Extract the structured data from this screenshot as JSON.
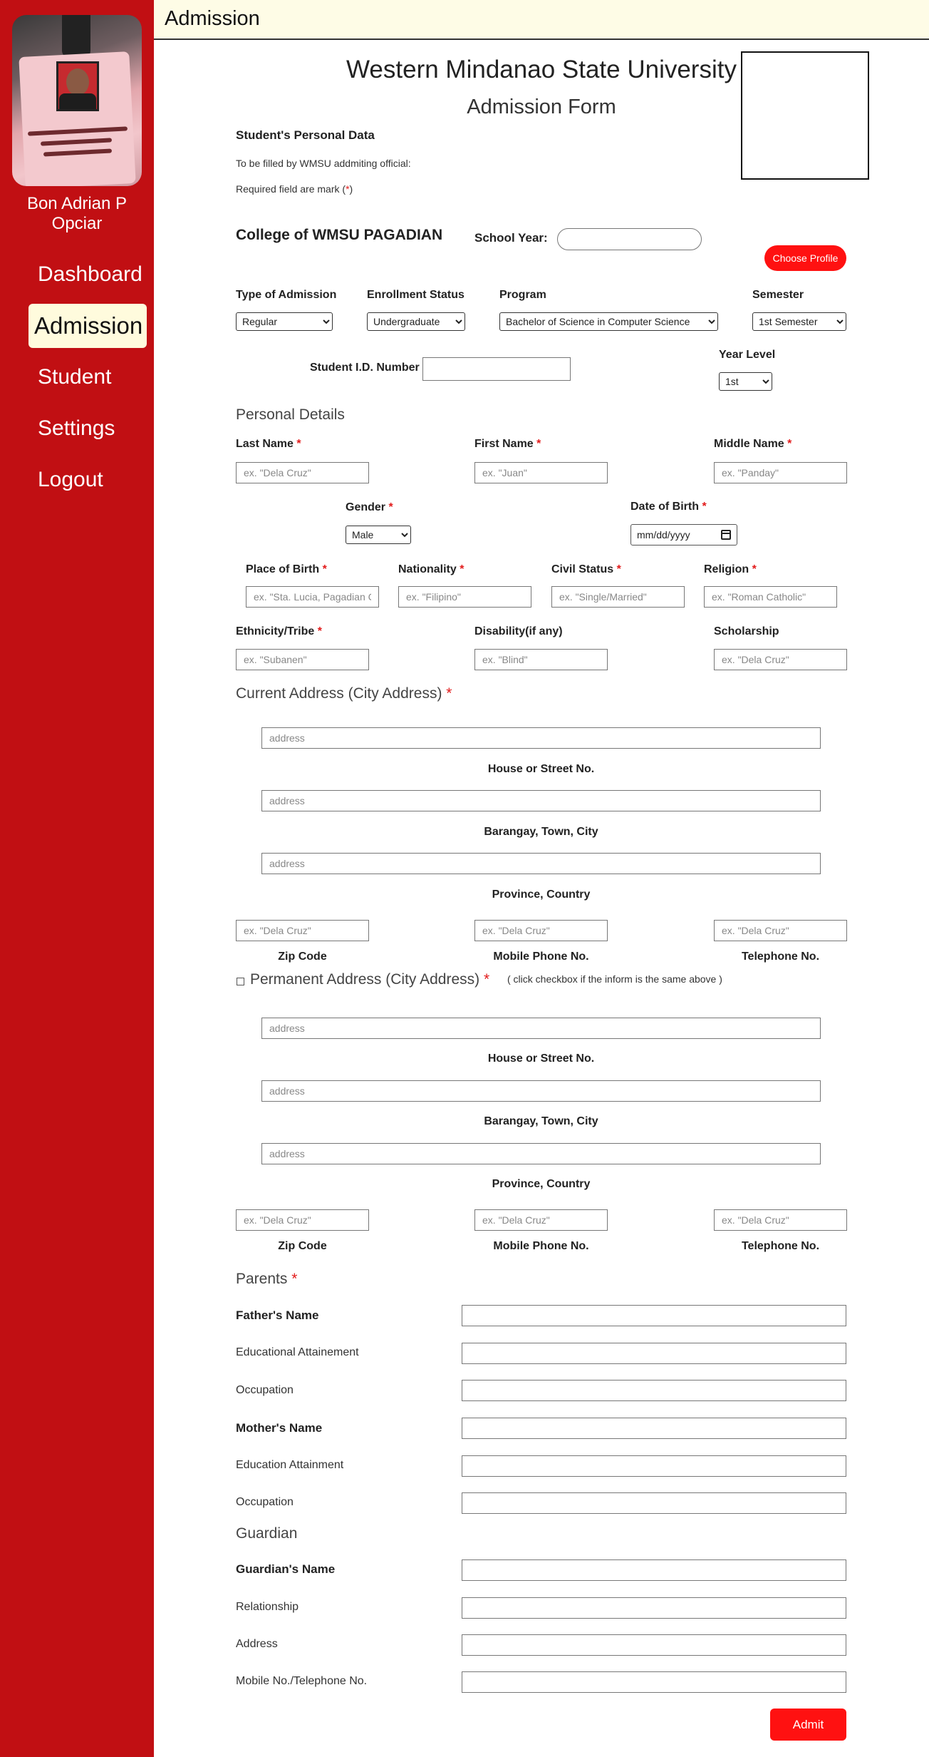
{
  "sidebar": {
    "user_name": "Bon Adrian P Opciar",
    "nav": [
      "Dashboard",
      "Admission",
      "Student",
      "Settings",
      "Logout"
    ],
    "active": "Admission",
    "id_card_text": [
      "BON ADRIAN P. OPCIAR",
      "Instructor I",
      "WMSU PAGADIAN"
    ]
  },
  "topbar": {
    "title": "Admission"
  },
  "header": {
    "university": "Western Mindanao State University",
    "form_title": "Admission Form",
    "personal_data": "Student's Personal Data",
    "official_note": "To be filled by WMSU addmiting official:",
    "required_note": "Required field are mark (",
    "required_star": "*",
    "required_close": ")"
  },
  "college": {
    "name": "College of WMSU PAGADIAN",
    "school_year_label": "School Year:",
    "school_year_value": "",
    "choose_profile": "Choose Profile"
  },
  "admission": {
    "type_label": "Type of Admission",
    "type_value": "Regular",
    "status_label": "Enrollment Status",
    "status_value": "Undergraduate",
    "program_label": "Program",
    "program_value": "Bachelor of Science in Computer Science",
    "semester_label": "Semester",
    "semester_value": "1st Semester",
    "student_id_label": "Student I.D. Number",
    "student_id_value": "",
    "year_level_label": "Year Level",
    "year_level_value": "1st"
  },
  "personal": {
    "heading": "Personal Details",
    "last_name_label": "Last Name",
    "last_name_ph": "ex. \"Dela Cruz\"",
    "first_name_label": "First Name",
    "first_name_ph": "ex. \"Juan\"",
    "middle_name_label": "Middle Name",
    "middle_name_ph": "ex. \"Panday\"",
    "gender_label": "Gender",
    "gender_value": "Male",
    "dob_label": "Date of Birth",
    "dob_value": "mm/dd/yyyy",
    "pob_label": "Place of Birth",
    "pob_ph": "ex. \"Sta. Lucia, Pagadian City\"",
    "nationality_label": "Nationality",
    "nationality_ph": "ex. \"Filipino\"",
    "civil_label": "Civil Status",
    "civil_ph": "ex. \"Single/Married\"",
    "religion_label": "Religion",
    "religion_ph": "ex. \"Roman Catholic\"",
    "ethnicity_label": "Ethnicity/Tribe",
    "ethnicity_ph": "ex. \"Subanen\"",
    "disability_label": "Disability(if any)",
    "disability_ph": "ex. \"Blind\"",
    "scholarship_label": "Scholarship",
    "scholarship_ph": "ex. \"Dela Cruz\""
  },
  "current_address": {
    "heading": "Current Address (City Address)",
    "address_ph": "address",
    "house_label": "House or Street No.",
    "barangay_label": "Barangay, Town, City",
    "province_label": "Province, Country",
    "zip_label": "Zip Code",
    "mobile_label": "Mobile Phone No.",
    "tel_label": "Telephone No.",
    "small_ph": "ex. \"Dela Cruz\""
  },
  "permanent_address": {
    "heading": "Permanent Address (City Address)",
    "note": "( click checkbox if the inform is the same above )",
    "address_ph": "address",
    "house_label": "House or Street No.",
    "barangay_label": "Barangay, Town, City",
    "province_label": "Province, Country",
    "zip_label": "Zip Code",
    "mobile_label": "Mobile Phone No.",
    "tel_label": "Telephone No.",
    "small_ph": "ex. \"Dela Cruz\""
  },
  "parents": {
    "heading": "Parents",
    "father": "Father's Name",
    "father_edu": "Educational Attainement",
    "father_occ": "Occupation",
    "mother": "Mother's Name",
    "mother_edu": "Education Attainment",
    "mother_occ": "Occupation"
  },
  "guardian": {
    "heading": "Guardian",
    "name": "Guardian's Name",
    "relationship": "Relationship",
    "address": "Address",
    "phone": "Mobile No./Telephone No."
  },
  "actions": {
    "submit": "Admit"
  }
}
